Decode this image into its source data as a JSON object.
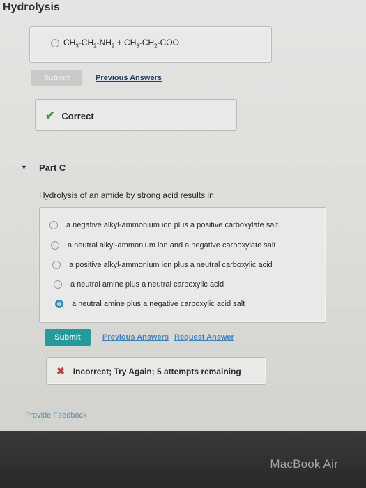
{
  "header": {
    "title": "Hydrolysis"
  },
  "part_b": {
    "selected_answer": {
      "m1": "CH",
      "s1": "3",
      "m2": "-CH",
      "s2": "2",
      "m3": "-NH",
      "s3": "2",
      "m4": " + CH",
      "s4": "3",
      "m5": "-CH",
      "s5": "2",
      "m6": "-COO",
      "sup": "−"
    },
    "submit_label": "Submit",
    "previous_answers_label": "Previous Answers",
    "feedback": "Correct"
  },
  "part_c": {
    "title": "Part C",
    "question": "Hydrolysis of an amide by strong acid results in",
    "options": [
      "a negative alkyl-ammonium ion plus a positive carboxylate salt",
      "a neutral alkyl-ammonium ion and a negative carboxylate salt",
      "a positive alkyl-ammonium ion plus a neutral carboxylic acid",
      "a neutral amine plus a neutral carboxylic acid",
      "a neutral amine plus a negative carboxylic acid salt"
    ],
    "selected_index": 4,
    "submit_label": "Submit",
    "previous_answers_label": "Previous Answers",
    "request_answer_label": "Request Answer",
    "feedback": "Incorrect; Try Again; 5 attempts remaining"
  },
  "footer": {
    "provide_feedback": "Provide Feedback"
  },
  "device": {
    "brand": "MacBook Air"
  },
  "colors": {
    "accent": "#239a9b",
    "correct": "#2e9a3e",
    "incorrect": "#d8322a",
    "selected_radio": "#2b8fd6"
  }
}
